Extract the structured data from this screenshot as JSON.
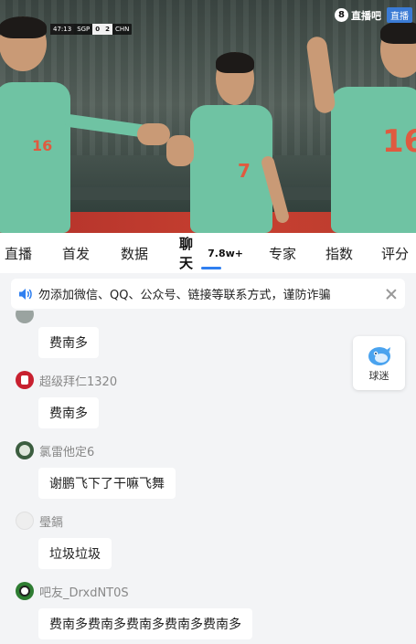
{
  "video": {
    "scoreboard": {
      "time": "47:13",
      "home": "SGP",
      "home_score": "0",
      "away_score": "2",
      "away": "CHN"
    },
    "logo_text": "直播吧",
    "live_badge": "直播",
    "jersey_numbers": [
      "16",
      "7",
      "16"
    ]
  },
  "tabs": [
    {
      "label": "直播",
      "active": false
    },
    {
      "label": "首发",
      "active": false
    },
    {
      "label": "数据",
      "active": false
    },
    {
      "label": "聊天",
      "count": "7.8w+",
      "active": true
    },
    {
      "label": "专家",
      "active": false
    },
    {
      "label": "指数",
      "active": false
    },
    {
      "label": "评分",
      "active": false
    }
  ],
  "notice": {
    "text": "勿添加微信、QQ、公众号、链接等联系方式，谨防诈骗",
    "icon": "speaker-icon"
  },
  "fans_button": {
    "label": "球迷",
    "icon": "fan-bird-icon"
  },
  "messages": [
    {
      "username": "",
      "text": "费南多",
      "avatar_color": "#9aa3a0"
    },
    {
      "username": "超级拜仁1320",
      "text": "费南多",
      "avatar_color": "#c8202f"
    },
    {
      "username": "氯雷他定6",
      "text": "谢鹏飞下了干嘛飞舞",
      "avatar_color": "#3b5d3f"
    },
    {
      "username": "璺鎘",
      "text": "垃圾垃圾",
      "avatar_color": "#eeeeee"
    },
    {
      "username": "吧友_DrxdNT0S",
      "text": "费南多费南多费南多费南多费南多",
      "avatar_color": "#2e7d32"
    }
  ],
  "colors": {
    "accent": "#2f7ff0",
    "jersey": "#6fc3a3",
    "background": "#f3f4f6"
  }
}
